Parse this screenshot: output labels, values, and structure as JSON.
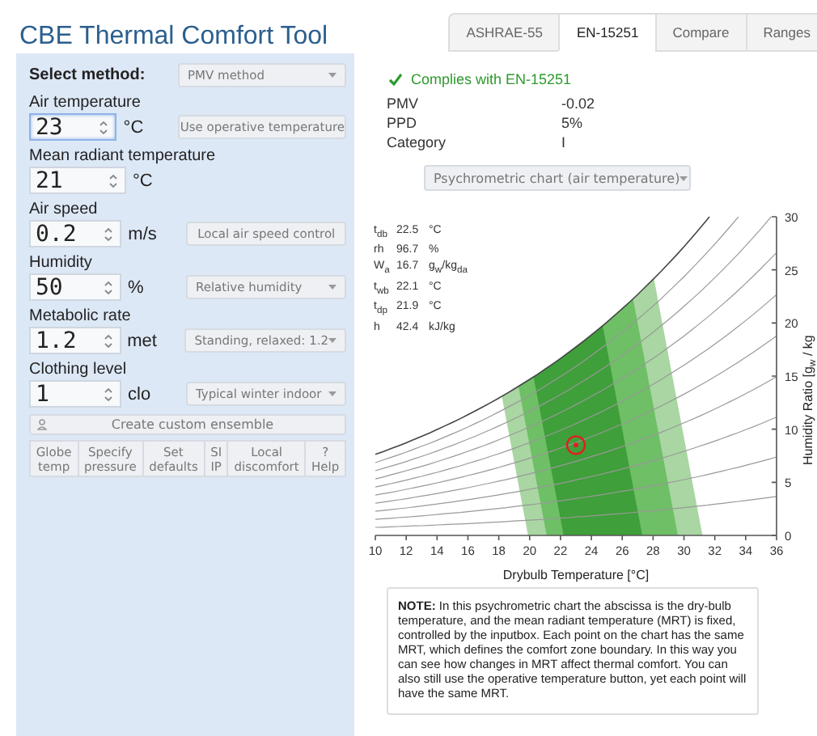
{
  "title": "CBE Thermal Comfort Tool",
  "tabs": [
    {
      "label": "ASHRAE-55",
      "selected": false
    },
    {
      "label": "EN-15251",
      "selected": true
    },
    {
      "label": "Compare",
      "selected": false
    },
    {
      "label": "Ranges",
      "selected": false
    }
  ],
  "sidebar": {
    "method_label": "Select method:",
    "method": "PMV method",
    "inputs": [
      {
        "label": "Air temperature",
        "value": "23",
        "unit": "°C",
        "focused": true,
        "control": {
          "kind": "button",
          "label": "Use operative temperature"
        }
      },
      {
        "label": "Mean radiant temperature",
        "value": "21",
        "unit": "°C",
        "focused": false
      },
      {
        "label": "Air speed",
        "value": "0.2",
        "unit": "m/s",
        "focused": false,
        "control": {
          "kind": "button",
          "label": "Local air speed control"
        }
      },
      {
        "label": "Humidity",
        "value": "50",
        "unit": "%",
        "focused": false,
        "control": {
          "kind": "select",
          "label": "Relative humidity"
        }
      },
      {
        "label": "Metabolic rate",
        "value": "1.2",
        "unit": "met",
        "focused": false,
        "control": {
          "kind": "select",
          "label": "Standing, relaxed: 1.2"
        }
      },
      {
        "label": "Clothing level",
        "value": "1",
        "unit": "clo",
        "focused": false,
        "control": {
          "kind": "select",
          "label": "Typical winter indoor"
        }
      }
    ],
    "ensemble_button": "Create custom ensemble",
    "buttons": [
      "Globe\ntemp",
      "Specify\npressure",
      "Set\ndefaults",
      "SI\nIP",
      "Local\ndiscomfort",
      "?\nHelp"
    ]
  },
  "results": {
    "status": "Complies with EN-15251",
    "complies": true,
    "rows": [
      {
        "label": "PMV",
        "value": "-0.02"
      },
      {
        "label": "PPD",
        "value": "5%"
      },
      {
        "label": "Category",
        "value": "I"
      }
    ]
  },
  "chart_select": "Psychrometric chart (air temperature)",
  "readout": [
    {
      "label": "t$_{db}$",
      "value": "22.5",
      "unit": "°C"
    },
    {
      "label": "rh",
      "value": "96.7",
      "unit": "%"
    },
    {
      "label": "W$_{a}$",
      "value": "16.7",
      "unit": "g$_{w}$/kg$_{da}$"
    },
    {
      "label": "t$_{wb}$",
      "value": "22.1",
      "unit": "°C"
    },
    {
      "label": "t$_{dp}$",
      "value": "21.9",
      "unit": "°C"
    },
    {
      "label": "h",
      "value": "42.4",
      "unit": "kJ/kg"
    }
  ],
  "chart_data": {
    "type": "scatter",
    "xlabel": "Drybulb Temperature [°C]",
    "ylabel": "Humidity Ratio [g$_{w}$ / kg",
    "xlim": [
      10,
      36
    ],
    "ylim": [
      0,
      30
    ],
    "xticks": [
      10,
      12,
      14,
      16,
      18,
      20,
      22,
      24,
      26,
      28,
      30,
      32,
      34,
      36
    ],
    "yticks": [
      0,
      5,
      10,
      15,
      20,
      25,
      30
    ],
    "x": [
      23
    ],
    "series": [
      {
        "color": "#e02020",
        "values": [
          8.5
        ]
      }
    ]
  },
  "note": "**NOTE:** In this psychrometric chart the abscissa is the dry-bulb temperature, and the mean radiant temperature (MRT) is fixed, controlled by the inputbox. Each point on the chart has the same MRT, which defines the comfort zone boundary. In this way you can see how changes in MRT affect thermal comfort. You can also still use the operative temperature button, yet each point will have the same MRT."
}
